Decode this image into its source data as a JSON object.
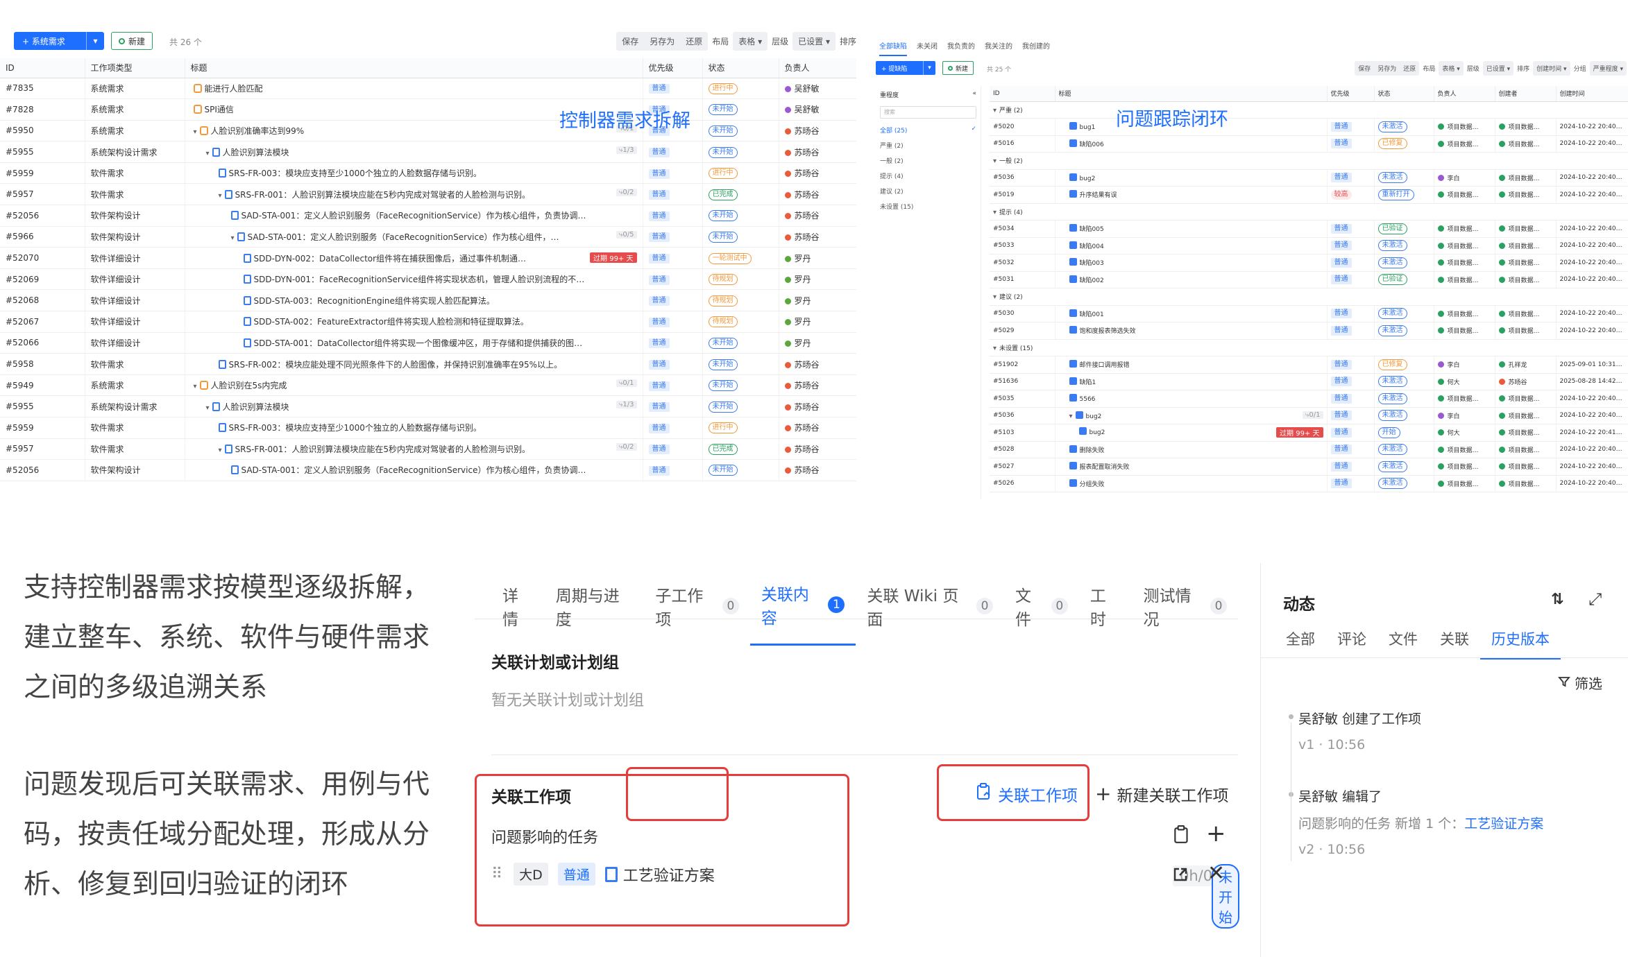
{
  "panel_req": {
    "add_btn": "系统需求",
    "new_btn": "新建",
    "count": "共 26 个",
    "tools": {
      "save": "保存",
      "save_as": "另存为",
      "restore": "还原",
      "layout_label": "布局",
      "layout_value": "表格",
      "level_label": "层级",
      "level_value": "已设置",
      "sort_label": "排序"
    },
    "columns": [
      "ID",
      "工作项类型",
      "标题",
      "优先级",
      "状态",
      "负责人"
    ],
    "callout": "控制器需求拆解",
    "rows": [
      {
        "id": "#7835",
        "type": "系统需求",
        "title": "能进行人脸匹配",
        "indent": 0,
        "chev": false,
        "icon": "req",
        "sub": "",
        "overdue": "",
        "priority": "普通",
        "status": "进行中",
        "status_color": "org",
        "owner": "吴舒敏",
        "owner_color": "#9b59d0"
      },
      {
        "id": "#7828",
        "type": "系统需求",
        "title": "SPI通信",
        "indent": 0,
        "chev": false,
        "icon": "req",
        "sub": "",
        "overdue": "",
        "priority": "普通",
        "status": "未开始",
        "status_color": "blue",
        "owner": "吴舒敏",
        "owner_color": "#9b59d0"
      },
      {
        "id": "#5950",
        "type": "系统需求",
        "title": "人脸识别准确率达到99%",
        "indent": 0,
        "chev": true,
        "icon": "req",
        "sub": "0/1",
        "overdue": "",
        "priority": "普通",
        "status": "未开始",
        "status_color": "blue",
        "owner": "苏旸谷",
        "owner_color": "#e85c3c"
      },
      {
        "id": "#5955",
        "type": "系统架构设计需求",
        "title": "人脸识别算法模块",
        "indent": 1,
        "chev": true,
        "icon": "doc",
        "sub": "1/3",
        "overdue": "",
        "priority": "普通",
        "status": "未开始",
        "status_color": "blue",
        "owner": "苏旸谷",
        "owner_color": "#e85c3c"
      },
      {
        "id": "#5959",
        "type": "软件需求",
        "title": "SRS-FR-003：模块应支持至少1000个独立的人脸数据存储与识别。",
        "indent": 2,
        "chev": false,
        "icon": "doc",
        "sub": "",
        "overdue": "",
        "priority": "普通",
        "status": "进行中",
        "status_color": "org",
        "owner": "苏旸谷",
        "owner_color": "#e85c3c"
      },
      {
        "id": "#5957",
        "type": "软件需求",
        "title": "SRS-FR-001：人脸识别算法模块应能在5秒内完成对驾驶者的人脸检测与识别。",
        "indent": 2,
        "chev": true,
        "icon": "doc",
        "sub": "0/2",
        "overdue": "",
        "priority": "普通",
        "status": "已完成",
        "status_color": "grn",
        "owner": "苏旸谷",
        "owner_color": "#e85c3c"
      },
      {
        "id": "#52056",
        "type": "软件架构设计",
        "title": "SAD-STA-001：定义人脸识别服务（FaceRecognitionService）作为核心组件，负责协调…",
        "indent": 3,
        "chev": false,
        "icon": "doc",
        "sub": "",
        "overdue": "",
        "priority": "普通",
        "status": "未开始",
        "status_color": "blue",
        "owner": "苏旸谷",
        "owner_color": "#e85c3c"
      },
      {
        "id": "#5966",
        "type": "软件架构设计",
        "title": "SAD-STA-001：定义人脸识别服务（FaceRecognitionService）作为核心组件，…",
        "indent": 3,
        "chev": true,
        "icon": "doc",
        "sub": "0/5",
        "overdue": "",
        "priority": "普通",
        "status": "未开始",
        "status_color": "blue",
        "owner": "苏旸谷",
        "owner_color": "#e85c3c"
      },
      {
        "id": "#52070",
        "type": "软件详细设计",
        "title": "SDD-DYN-002：DataCollector组件将在捕获图像后，通过事件机制通…",
        "indent": 4,
        "chev": false,
        "icon": "doc",
        "sub": "",
        "overdue": "过期 99+ 天",
        "priority": "普通",
        "status": "一轮测试中",
        "status_color": "org",
        "owner": "罗丹",
        "owner_color": "#5aa83c"
      },
      {
        "id": "#52069",
        "type": "软件详细设计",
        "title": "SDD-DYN-001：FaceRecognitionService组件将实现状态机，管理人脸识别流程的不…",
        "indent": 4,
        "chev": false,
        "icon": "doc",
        "sub": "",
        "overdue": "",
        "priority": "普通",
        "status": "待规划",
        "status_color": "org",
        "owner": "罗丹",
        "owner_color": "#5aa83c"
      },
      {
        "id": "#52068",
        "type": "软件详细设计",
        "title": "SDD-STA-003：RecognitionEngine组件将实现人脸匹配算法。",
        "indent": 4,
        "chev": false,
        "icon": "doc",
        "sub": "",
        "overdue": "",
        "priority": "普通",
        "status": "待规划",
        "status_color": "org",
        "owner": "罗丹",
        "owner_color": "#5aa83c"
      },
      {
        "id": "#52067",
        "type": "软件详细设计",
        "title": "SDD-STA-002：FeatureExtractor组件将实现人脸检测和特征提取算法。",
        "indent": 4,
        "chev": false,
        "icon": "doc",
        "sub": "",
        "overdue": "",
        "priority": "普通",
        "status": "待规划",
        "status_color": "org",
        "owner": "罗丹",
        "owner_color": "#5aa83c"
      },
      {
        "id": "#52066",
        "type": "软件详细设计",
        "title": "SDD-STA-001：DataCollector组件将实现一个图像缓冲区，用于存储和提供捕获的图…",
        "indent": 4,
        "chev": false,
        "icon": "doc",
        "sub": "",
        "overdue": "",
        "priority": "普通",
        "status": "未开始",
        "status_color": "blue",
        "owner": "罗丹",
        "owner_color": "#5aa83c"
      },
      {
        "id": "#5958",
        "type": "软件需求",
        "title": "SRS-FR-002：模块应能处理不同光照条件下的人脸图像，并保持识别准确率在95%以上。",
        "indent": 2,
        "chev": false,
        "icon": "doc",
        "sub": "",
        "overdue": "",
        "priority": "普通",
        "status": "未开始",
        "status_color": "blue",
        "owner": "苏旸谷",
        "owner_color": "#e85c3c"
      },
      {
        "id": "#5949",
        "type": "系统需求",
        "title": "人脸识别在5s内完成",
        "indent": 0,
        "chev": true,
        "icon": "req",
        "sub": "0/1",
        "overdue": "",
        "priority": "普通",
        "status": "未开始",
        "status_color": "blue",
        "owner": "苏旸谷",
        "owner_color": "#e85c3c"
      },
      {
        "id": "#5955",
        "type": "系统架构设计需求",
        "title": "人脸识别算法模块",
        "indent": 1,
        "chev": true,
        "icon": "doc",
        "sub": "1/3",
        "overdue": "",
        "priority": "普通",
        "status": "未开始",
        "status_color": "blue",
        "owner": "苏旸谷",
        "owner_color": "#e85c3c"
      },
      {
        "id": "#5959",
        "type": "软件需求",
        "title": "SRS-FR-003：模块应支持至少1000个独立的人脸数据存储与识别。",
        "indent": 2,
        "chev": false,
        "icon": "doc",
        "sub": "",
        "overdue": "",
        "priority": "普通",
        "status": "进行中",
        "status_color": "org",
        "owner": "苏旸谷",
        "owner_color": "#e85c3c"
      },
      {
        "id": "#5957",
        "type": "软件需求",
        "title": "SRS-FR-001：人脸识别算法模块应能在5秒内完成对驾驶者的人脸检测与识别。",
        "indent": 2,
        "chev": true,
        "icon": "doc",
        "sub": "0/2",
        "overdue": "",
        "priority": "普通",
        "status": "已完成",
        "status_color": "grn",
        "owner": "苏旸谷",
        "owner_color": "#e85c3c"
      },
      {
        "id": "#52056",
        "type": "软件架构设计",
        "title": "SAD-STA-001：定义人脸识别服务（FaceRecognitionService）作为核心组件，负责协调…",
        "indent": 3,
        "chev": false,
        "icon": "doc",
        "sub": "",
        "overdue": "",
        "priority": "普通",
        "status": "未开始",
        "status_color": "blue",
        "owner": "苏旸谷",
        "owner_color": "#e85c3c"
      }
    ]
  },
  "panel_bug": {
    "tabs": [
      "全部缺陷",
      "未关闭",
      "我负责的",
      "我关注的",
      "我创建的"
    ],
    "add_btn": "提缺陷",
    "new_btn": "新建",
    "count": "共 25 个",
    "tools": {
      "save": "保存",
      "save_as": "另存为",
      "restore": "还原",
      "layout_label": "布局",
      "layout_value": "表格",
      "level_label": "层级",
      "level_value": "已设置",
      "sort_label": "排序",
      "sort_value": "创建时间",
      "group_label": "分组",
      "group_value": "严重程度"
    },
    "side_title": "重程度",
    "search_placeholder": "搜索",
    "side_items": [
      {
        "label": "全部 (25)",
        "on": true
      },
      {
        "label": "严重 (2)",
        "on": false
      },
      {
        "label": "一般 (2)",
        "on": false
      },
      {
        "label": "提示 (4)",
        "on": false
      },
      {
        "label": "建议 (2)",
        "on": false
      },
      {
        "label": "未设置 (15)",
        "on": false
      }
    ],
    "columns": [
      "ID",
      "标题",
      "优先级",
      "状态",
      "负责人",
      "创建者",
      "创建时间"
    ],
    "callout": "问题跟踪闭环",
    "rows": [
      {
        "group": "严重 (2)"
      },
      {
        "id": "#5020",
        "title": "bug1",
        "indent": 0,
        "chev": false,
        "sub": "",
        "overdue": "",
        "priority": "普通",
        "status": "未激活",
        "status_color": "blue",
        "owner": "项目数据…",
        "owner_color": "#2aa160",
        "creator": "项目数据…",
        "creator_color": "#2aa160",
        "time": "2024-10-22 20:40…"
      },
      {
        "id": "#5016",
        "title": "缺陷006",
        "indent": 0,
        "chev": false,
        "sub": "",
        "overdue": "",
        "priority": "普通",
        "status": "已修复",
        "status_color": "org",
        "owner": "项目数据…",
        "owner_color": "#2aa160",
        "creator": "项目数据…",
        "creator_color": "#2aa160",
        "time": "2024-10-22 20:40…"
      },
      {
        "group": "一般 (2)"
      },
      {
        "id": "#5036",
        "title": "bug2",
        "indent": 0,
        "chev": false,
        "sub": "",
        "overdue": "",
        "priority": "普通",
        "status": "未激活",
        "status_color": "blue",
        "owner": "李白",
        "owner_color": "#9b59d0",
        "creator": "项目数据…",
        "creator_color": "#2aa160",
        "time": "2024-10-22 20:40…"
      },
      {
        "id": "#5019",
        "title": "升序结果有误",
        "indent": 0,
        "chev": false,
        "sub": "",
        "overdue": "",
        "priority": "较高",
        "status": "重新打开",
        "status_color": "blue",
        "owner": "项目数据…",
        "owner_color": "#2aa160",
        "creator": "项目数据…",
        "creator_color": "#2aa160",
        "time": "2024-10-22 20:40…"
      },
      {
        "group": "提示 (4)"
      },
      {
        "id": "#5034",
        "title": "缺陷005",
        "indent": 0,
        "chev": false,
        "sub": "",
        "overdue": "",
        "priority": "普通",
        "status": "已验证",
        "status_color": "grn",
        "owner": "项目数据…",
        "owner_color": "#2aa160",
        "creator": "项目数据…",
        "creator_color": "#2aa160",
        "time": "2024-10-22 20:40…"
      },
      {
        "id": "#5033",
        "title": "缺陷004",
        "indent": 0,
        "chev": false,
        "sub": "",
        "overdue": "",
        "priority": "普通",
        "status": "未激活",
        "status_color": "blue",
        "owner": "项目数据…",
        "owner_color": "#2aa160",
        "creator": "项目数据…",
        "creator_color": "#2aa160",
        "time": "2024-10-22 20:40…"
      },
      {
        "id": "#5032",
        "title": "缺陷003",
        "indent": 0,
        "chev": false,
        "sub": "",
        "overdue": "",
        "priority": "普通",
        "status": "未激活",
        "status_color": "blue",
        "owner": "项目数据…",
        "owner_color": "#2aa160",
        "creator": "项目数据…",
        "creator_color": "#2aa160",
        "time": "2024-10-22 20:40…"
      },
      {
        "id": "#5031",
        "title": "缺陷002",
        "indent": 0,
        "chev": false,
        "sub": "",
        "overdue": "",
        "priority": "普通",
        "status": "已验证",
        "status_color": "grn",
        "owner": "项目数据…",
        "owner_color": "#2aa160",
        "creator": "项目数据…",
        "creator_color": "#2aa160",
        "time": "2024-10-22 20:40…"
      },
      {
        "group": "建议 (2)"
      },
      {
        "id": "#5030",
        "title": "缺陷001",
        "indent": 0,
        "chev": false,
        "sub": "",
        "overdue": "",
        "priority": "普通",
        "status": "未激活",
        "status_color": "blue",
        "owner": "项目数据…",
        "owner_color": "#2aa160",
        "creator": "项目数据…",
        "creator_color": "#2aa160",
        "time": "2024-10-22 20:40…"
      },
      {
        "id": "#5029",
        "title": "饱和度报表筛选失效",
        "indent": 0,
        "chev": false,
        "sub": "",
        "overdue": "",
        "priority": "普通",
        "status": "未激活",
        "status_color": "blue",
        "owner": "项目数据…",
        "owner_color": "#2aa160",
        "creator": "项目数据…",
        "creator_color": "#2aa160",
        "time": "2024-10-22 20:40…"
      },
      {
        "group": "未设置 (15)"
      },
      {
        "id": "#51902",
        "title": "邮件接口调用报错",
        "indent": 0,
        "chev": false,
        "sub": "",
        "overdue": "",
        "priority": "普通",
        "status": "已修复",
        "status_color": "org",
        "owner": "李白",
        "owner_color": "#9b59d0",
        "creator": "孔祥龙",
        "creator_color": "#2aa160",
        "time": "2025-09-01 10:31…"
      },
      {
        "id": "#51636",
        "title": "缺陷1",
        "indent": 0,
        "chev": false,
        "sub": "",
        "overdue": "",
        "priority": "普通",
        "status": "未激活",
        "status_color": "blue",
        "owner": "何大",
        "owner_color": "#2aa160",
        "creator": "苏旸谷",
        "creator_color": "#e85c3c",
        "time": "2025-08-28 14:42…"
      },
      {
        "id": "#5035",
        "title": "5566",
        "indent": 0,
        "chev": false,
        "sub": "",
        "overdue": "",
        "priority": "普通",
        "status": "未激活",
        "status_color": "blue",
        "owner": "项目数据…",
        "owner_color": "#2aa160",
        "creator": "项目数据…",
        "creator_color": "#2aa160",
        "time": "2024-10-22 20:40…"
      },
      {
        "id": "#5036",
        "title": "bug2",
        "indent": 0,
        "chev": true,
        "sub": "0/1",
        "overdue": "",
        "priority": "普通",
        "status": "未激活",
        "status_color": "blue",
        "owner": "李白",
        "owner_color": "#9b59d0",
        "creator": "项目数据…",
        "creator_color": "#2aa160",
        "time": "2024-10-22 20:40…"
      },
      {
        "id": "#5103",
        "title": "bug2",
        "indent": 1,
        "chev": false,
        "sub": "",
        "overdue": "过期 99+ 天",
        "priority": "普通",
        "status": "开始",
        "status_color": "blue",
        "owner": "何大",
        "owner_color": "#2aa160",
        "creator": "项目数据…",
        "creator_color": "#2aa160",
        "time": "2024-10-22 20:41…"
      },
      {
        "id": "#5028",
        "title": "删除失败",
        "indent": 0,
        "chev": false,
        "sub": "",
        "overdue": "",
        "priority": "普通",
        "status": "未激活",
        "status_color": "blue",
        "owner": "项目数据…",
        "owner_color": "#2aa160",
        "creator": "项目数据…",
        "creator_color": "#2aa160",
        "time": "2024-10-22 20:40…"
      },
      {
        "id": "#5027",
        "title": "报表配置取消失败",
        "indent": 0,
        "chev": false,
        "sub": "",
        "overdue": "",
        "priority": "普通",
        "status": "未激活",
        "status_color": "blue",
        "owner": "项目数据…",
        "owner_color": "#2aa160",
        "creator": "项目数据…",
        "creator_color": "#2aa160",
        "time": "2024-10-22 20:40…"
      },
      {
        "id": "#5026",
        "title": "分组失败",
        "indent": 0,
        "chev": false,
        "sub": "",
        "overdue": "",
        "priority": "普通",
        "status": "未激活",
        "status_color": "blue",
        "owner": "项目数据…",
        "owner_color": "#2aa160",
        "creator": "项目数据…",
        "creator_color": "#2aa160",
        "time": "2024-10-22 20:40…"
      }
    ]
  },
  "text_blocks": {
    "block1": [
      "支持控制器需求按模型逐级拆解，",
      "建立整车、系统、软件与硬件需求",
      "之间的多级追溯关系"
    ],
    "block2": [
      "问题发现后可关联需求、用例与代",
      "码，按责任域分配处理，形成从分",
      "析、修复到回归验证的闭环"
    ]
  },
  "detail": {
    "tabs": [
      {
        "label": "详情",
        "count": "",
        "on": false
      },
      {
        "label": "周期与进度",
        "count": "",
        "on": false
      },
      {
        "label": "子工作项",
        "count": "0",
        "on": false
      },
      {
        "label": "关联内容",
        "count": "1",
        "on": true
      },
      {
        "label": "关联 Wiki 页面",
        "count": "0",
        "on": false
      },
      {
        "label": "文件",
        "count": "0",
        "on": false
      },
      {
        "label": "工时",
        "count": "",
        "on": false
      },
      {
        "label": "测试情况",
        "count": "0",
        "on": false
      }
    ],
    "plan_title": "关联计划或计划组",
    "plan_empty": "暂无关联计划或计划组",
    "items_title": "关联工作项",
    "link_btn": "关联工作项",
    "new_link_btn": "新建关联工作项",
    "group_label": "问题影响的任务",
    "item": {
      "chip1": "大D",
      "chip2": "普通",
      "title": "工艺验证方案",
      "hours": "0h/0h",
      "status": "未开始"
    }
  },
  "activity": {
    "title": "动态",
    "tabs": [
      {
        "label": "全部",
        "on": false
      },
      {
        "label": "评论",
        "on": false
      },
      {
        "label": "文件",
        "on": false
      },
      {
        "label": "关联",
        "on": false
      },
      {
        "label": "历史版本",
        "on": true
      }
    ],
    "filter": "筛选",
    "entries": [
      {
        "line": "吴舒敏 创建了工作项",
        "detail": "",
        "link": "",
        "meta": "v1 · 10:56"
      },
      {
        "line": "吴舒敏 编辑了",
        "detail": "问题影响的任务  新增 1 个：",
        "link": "工艺验证方案",
        "meta": "v2 · 10:56"
      }
    ]
  },
  "colors": {
    "accent": "#1e6fff",
    "highlight_box": "#e63c3c",
    "ok": "#2aa160"
  }
}
